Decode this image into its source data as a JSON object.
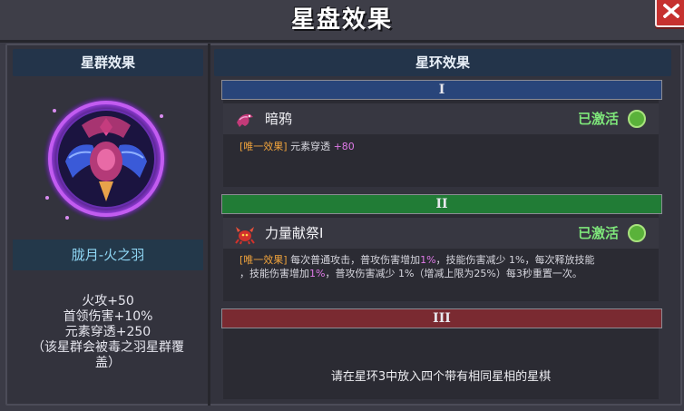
{
  "window": {
    "title": "星盘效果"
  },
  "left_panel": {
    "header": "星群效果",
    "stone_name": "胧月-火之羽",
    "stats": [
      "火攻+50",
      "首领伤害+10%",
      "元素穿透+250",
      "（该星群会被毒之羽星群覆",
      "盖）"
    ]
  },
  "right_panel": {
    "header": "星环效果",
    "rings": [
      {
        "label": "I",
        "effect_name": "暗鸦",
        "status": "已激活",
        "icon": "crow-icon",
        "desc_tag": "[唯一效果]",
        "desc_parts": [
          "元素穿透 ",
          "+80"
        ]
      },
      {
        "label": "II",
        "effect_name": "力量献祭Ⅰ",
        "status": "已激活",
        "icon": "crab-demon-icon",
        "desc_tag": "[唯一效果]",
        "desc_line1": [
          "每次普通攻击，普攻伤害增加",
          "1%",
          "，技能伤害减少 1%，每次释放技能"
        ],
        "desc_line2": [
          "，技能伤害增加",
          "1%",
          "，普攻伤害减少 1%（增减上限为25%）每3秒重置一次。"
        ]
      },
      {
        "label": "III",
        "empty_text": "请在星环3中放入四个带有相同星相的星棋"
      }
    ]
  },
  "colors": {
    "ring1": "#29457a",
    "ring2": "#217c36",
    "ring3": "#7a2a31",
    "active": "#7ee67a",
    "tag": "#f0a33c",
    "highlight": "#e07ae8"
  }
}
